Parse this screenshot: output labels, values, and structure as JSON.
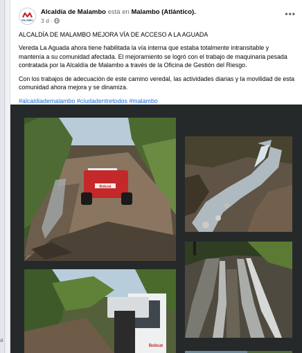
{
  "post": {
    "author": "Alcaldía de Malambo",
    "connector": "está en",
    "location": "Malambo (Atlántico).",
    "time": "3 d",
    "separator": "·",
    "more_icon": "more-horizontal-icon",
    "privacy_icon": "globe-icon",
    "logo_text": "MALAMBO"
  },
  "body": {
    "title": "ALCALDÍA DE MALAMBO MEJORA VÍA DE ACCESO A LA AGUADA",
    "paragraph1": "Vereda La Aguada ahora tiene habilitada la vía interna que estaba totalmente intransitable y mantenía a su comunidad afectada. El mejoramiento se logró con el trabajo de maquinaria pesada contratada por la Alcaldía de Malambo a través de la Oficina de Gestión del Riesgo.",
    "paragraph2": "Con los trabajos de adecuación de este camino veredal, las actividades diarias y la movilidad de esta comunidad ahora mejora y se dinamiza.",
    "hashtags": [
      "#alcaldiademalambo",
      "#ciudadentretodos",
      "#malambo"
    ]
  },
  "photos": {
    "loader_brand": "Bobcat",
    "count": 5
  },
  "colors": {
    "link": "#216fdb",
    "text": "#050505",
    "muted": "#65676b",
    "brand_red": "#c4282a",
    "photo_bg": "#25292a"
  },
  "left_hint": "a"
}
